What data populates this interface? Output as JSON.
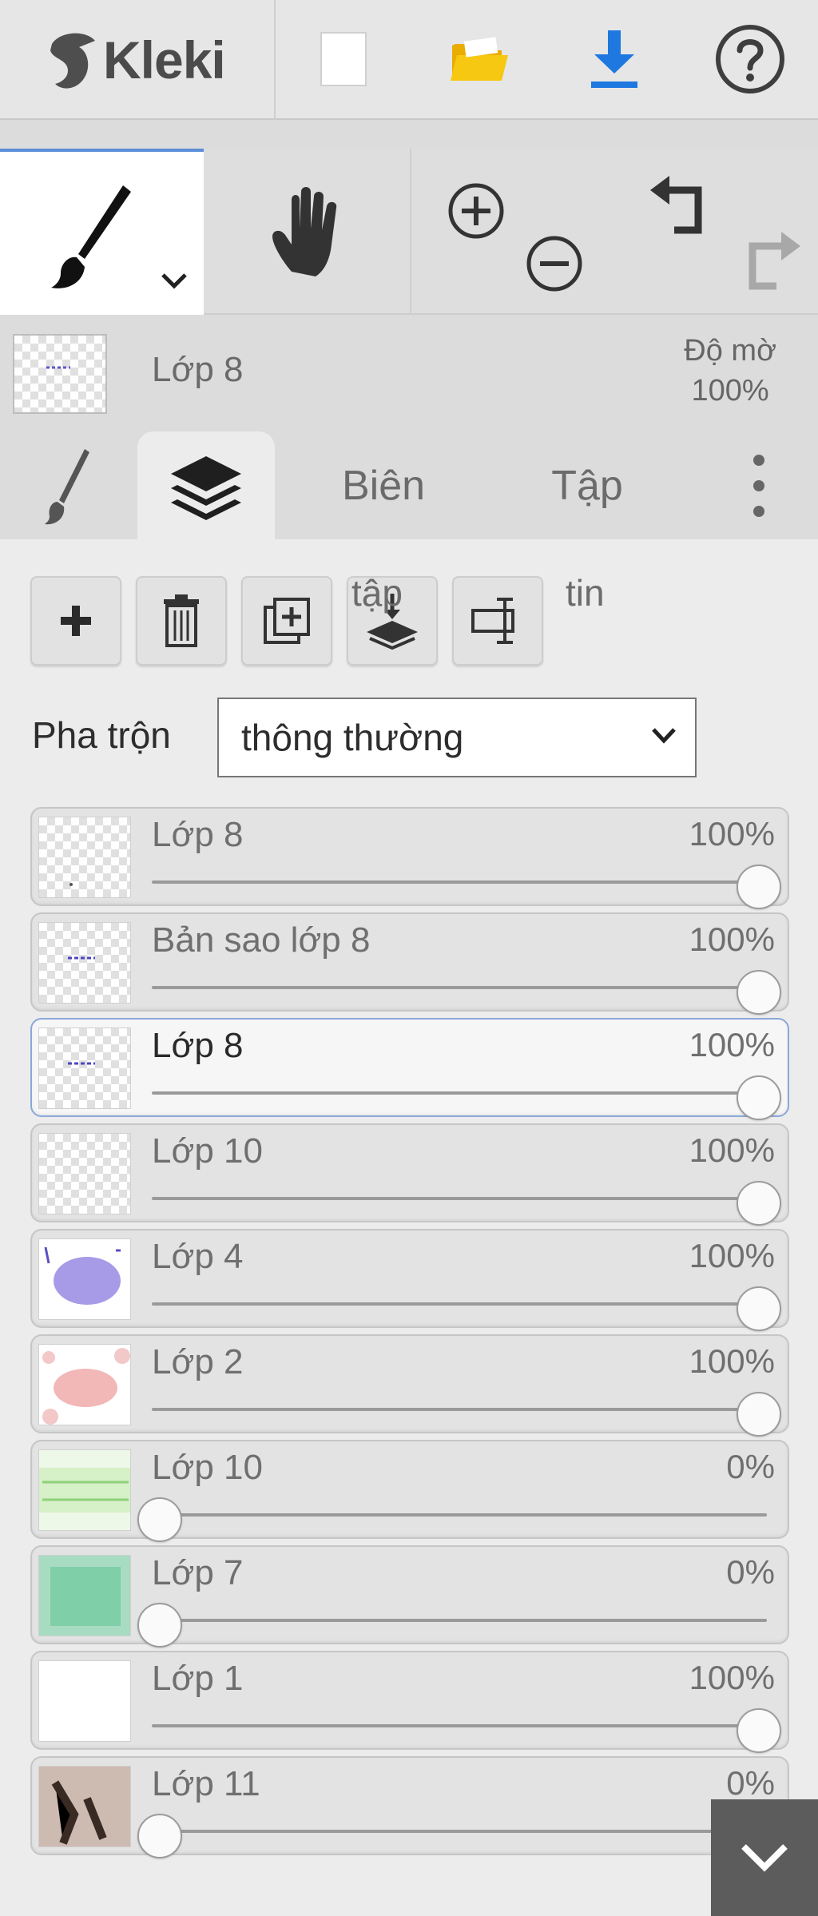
{
  "app": {
    "logo_text": "Kleki"
  },
  "layer_info": {
    "name": "Lớp 8",
    "opacity_label": "Độ mờ",
    "opacity_value": "100%"
  },
  "tabs": {
    "biên": "Biên",
    "tập": "Tập"
  },
  "panel": {
    "stray_text_1": "tập",
    "stray_text_2": "tin",
    "blend_label": "Pha trộn",
    "blend_value": "thông thường"
  },
  "layers": [
    {
      "name": "Lớp 8",
      "opacity_label": "100%",
      "opacity": 1.0,
      "active": false,
      "thumb": "transparent-dots"
    },
    {
      "name": "Bản sao lớp 8",
      "opacity_label": "100%",
      "opacity": 1.0,
      "active": false,
      "thumb": "transparent-blue-marks"
    },
    {
      "name": "Lớp 8",
      "opacity_label": "100%",
      "opacity": 1.0,
      "active": true,
      "thumb": "transparent-blue-marks"
    },
    {
      "name": "Lớp 10",
      "opacity_label": "100%",
      "opacity": 1.0,
      "active": false,
      "thumb": "transparent"
    },
    {
      "name": "Lớp 4",
      "opacity_label": "100%",
      "opacity": 1.0,
      "active": false,
      "thumb": "purple-blob"
    },
    {
      "name": "Lớp 2",
      "opacity_label": "100%",
      "opacity": 1.0,
      "active": false,
      "thumb": "pink-blob"
    },
    {
      "name": "Lớp 10",
      "opacity_label": "0%",
      "opacity": 0.0,
      "active": false,
      "thumb": "green-lines"
    },
    {
      "name": "Lớp 7",
      "opacity_label": "0%",
      "opacity": 0.0,
      "active": false,
      "thumb": "mint-texture"
    },
    {
      "name": "Lớp 1",
      "opacity_label": "100%",
      "opacity": 1.0,
      "active": false,
      "thumb": "white"
    },
    {
      "name": "Lớp 11",
      "opacity_label": "0%",
      "opacity": 0.0,
      "active": false,
      "thumb": "brown-photo"
    }
  ],
  "colors": {
    "accent": "#5a8ed8",
    "download": "#1e78e0",
    "folder": "#f5c000"
  }
}
